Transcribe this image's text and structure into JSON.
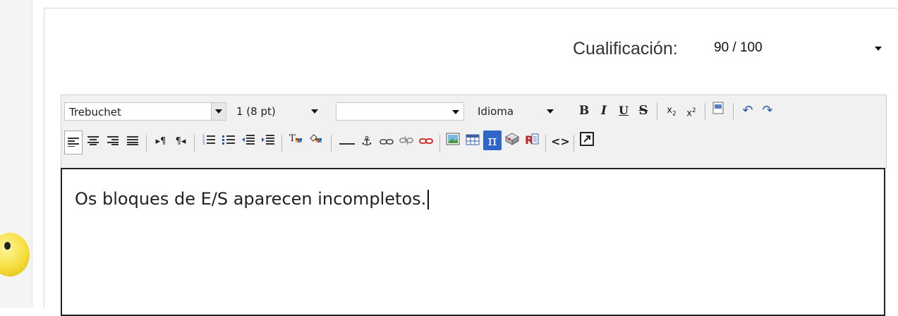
{
  "grade": {
    "label": "Cualificación:",
    "value": "90 / 100"
  },
  "toolbar": {
    "font_family": "Trebuchet",
    "font_size": "1 (8 pt)",
    "format_value": "",
    "language": "Idioma",
    "icons": [
      "bold-icon",
      "italic-icon",
      "underline-icon",
      "strikethrough-icon",
      "subscript-icon",
      "superscript-icon",
      "paste-word-icon",
      "undo-icon",
      "redo-icon",
      "align-left-icon",
      "align-center-icon",
      "align-right-icon",
      "justify-icon",
      "ltr-icon",
      "rtl-icon",
      "ordered-list-icon",
      "unordered-list-icon",
      "outdent-icon",
      "indent-icon",
      "text-color-icon",
      "background-color-icon",
      "horizontal-rule-icon",
      "anchor-icon",
      "link-icon",
      "unlink-icon",
      "no-link-icon",
      "image-icon",
      "table-icon",
      "math-icon",
      "dragmath-icon",
      "cleanup-icon",
      "html-source-icon",
      "fullscreen-icon"
    ]
  },
  "editor": {
    "text": "Os bloques de E/S aparecen incompletos."
  }
}
